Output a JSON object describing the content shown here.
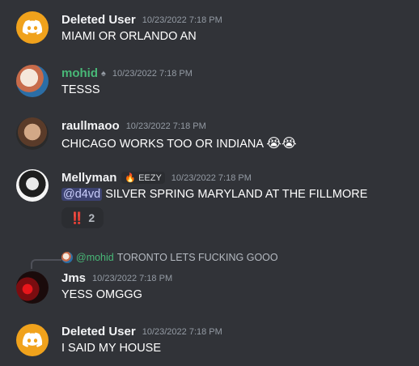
{
  "messages": [
    {
      "author": "Deleted User",
      "timestamp": "10/23/2022 7:18 PM",
      "text": "MIAMI OR ORLANDO AN",
      "avatar": "discord-logo-icon"
    },
    {
      "author": "mohid",
      "timestamp": "10/23/2022 7:18 PM",
      "text": "TESSS",
      "avatar": "user-photo"
    },
    {
      "author": "raullmaoo",
      "timestamp": "10/23/2022 7:18 PM",
      "text": "CHICAGO WORKS TOO OR INDIANA",
      "emoji": "😭😭"
    },
    {
      "author": "Mellyman",
      "tag": "EEZY",
      "timestamp": "10/23/2022 7:18 PM",
      "mention": "@d4vd",
      "text": "SILVER SPRING MARYLAND AT THE FILLMORE",
      "reaction": {
        "emoji": "‼️",
        "count": "2"
      }
    },
    {
      "reply": {
        "author": "@mohid",
        "text": "TORONTO LETS FUCKING GOOO"
      },
      "author": "Jms",
      "timestamp": "10/23/2022 7:18 PM",
      "text": "YESS OMGGG"
    },
    {
      "author": "Deleted User",
      "timestamp": "10/23/2022 7:18 PM",
      "text": "I SAID MY HOUSE",
      "avatar": "discord-logo-icon"
    }
  ],
  "colors": {
    "background": "#313338",
    "username_green": "#48b877",
    "mention_bg": "#3c4270"
  }
}
